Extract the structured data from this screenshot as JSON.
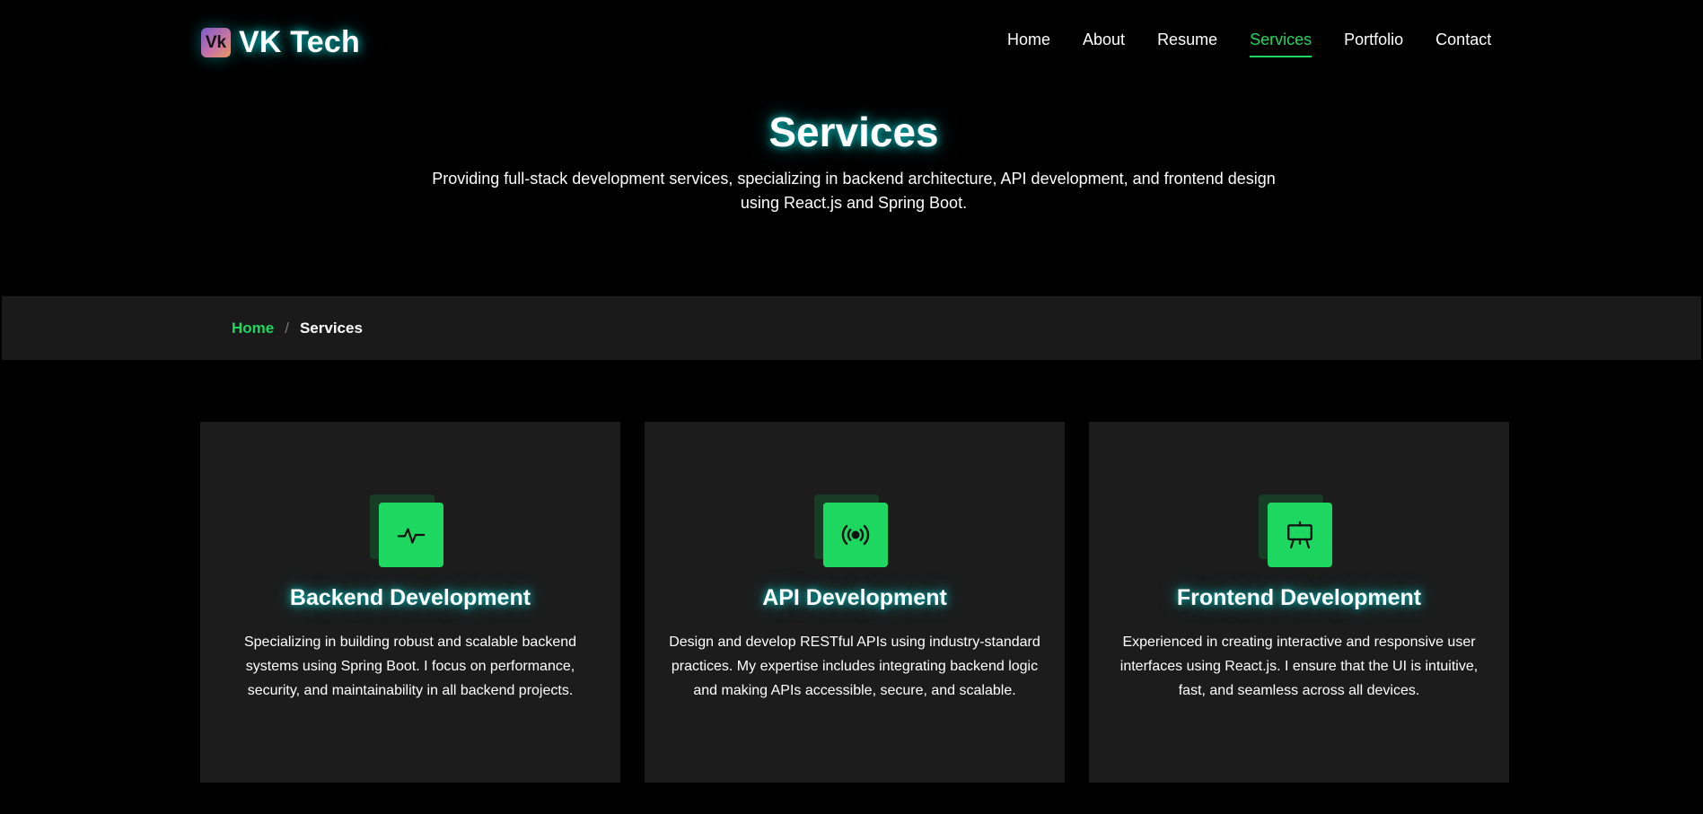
{
  "header": {
    "logo_badge": "Vk",
    "logo_text": "VK Tech",
    "nav": [
      {
        "label": "Home",
        "active": false
      },
      {
        "label": "About",
        "active": false
      },
      {
        "label": "Resume",
        "active": false
      },
      {
        "label": "Services",
        "active": true
      },
      {
        "label": "Portfolio",
        "active": false
      },
      {
        "label": "Contact",
        "active": false
      }
    ]
  },
  "hero": {
    "title": "Services",
    "subtitle": "Providing full-stack development services, specializing in backend architecture, API development, and frontend design using React.js and Spring Boot."
  },
  "breadcrumb": {
    "home": "Home",
    "separator": "/",
    "current": "Services"
  },
  "services": [
    {
      "icon": "activity-icon",
      "title": "Backend Development",
      "text": "Specializing in building robust and scalable backend systems using Spring Boot. I focus on performance, security, and maintainability in all backend projects."
    },
    {
      "icon": "broadcast-icon",
      "title": "API Development",
      "text": "Design and develop RESTful APIs using industry-standard practices. My expertise includes integrating backend logic and making APIs accessible, secure, and scalable."
    },
    {
      "icon": "easel-icon",
      "title": "Frontend Development",
      "text": "Experienced in creating interactive and responsive user interfaces using React.js. I ensure that the UI is intuitive, fast, and seamless across all devices."
    }
  ],
  "colors": {
    "background": "#000000",
    "accent": "#1ed760",
    "card": "#1c1c1c",
    "bar": "#1a1a1a",
    "glow": "#00e6e6"
  }
}
